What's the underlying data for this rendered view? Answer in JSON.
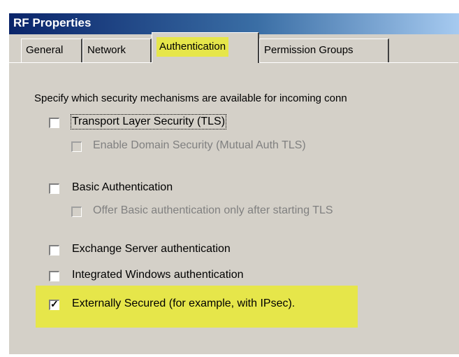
{
  "window": {
    "title": "RF Properties"
  },
  "tabs": [
    {
      "label": "General",
      "active": false
    },
    {
      "label": "Network",
      "active": false
    },
    {
      "label": "Authentication",
      "active": true
    },
    {
      "label": "Permission Groups",
      "active": false
    }
  ],
  "content": {
    "intro": "Specify which security mechanisms are available for incoming conn",
    "options": [
      {
        "label": "Transport Layer Security (TLS)",
        "checked": false,
        "enabled": true
      },
      {
        "label": "Enable Domain Security (Mutual Auth TLS)",
        "checked": false,
        "enabled": false
      },
      {
        "label": "Basic Authentication",
        "checked": false,
        "enabled": true
      },
      {
        "label": "Offer Basic authentication only after starting TLS",
        "checked": false,
        "enabled": false
      },
      {
        "label": "Exchange Server authentication",
        "checked": false,
        "enabled": true
      },
      {
        "label": "Integrated Windows authentication",
        "checked": false,
        "enabled": true
      },
      {
        "label": "Externally Secured (for example, with IPsec).",
        "checked": true,
        "enabled": true
      }
    ]
  },
  "colors": {
    "highlight": "#e6e64a",
    "title_bar": "#0a246a"
  }
}
